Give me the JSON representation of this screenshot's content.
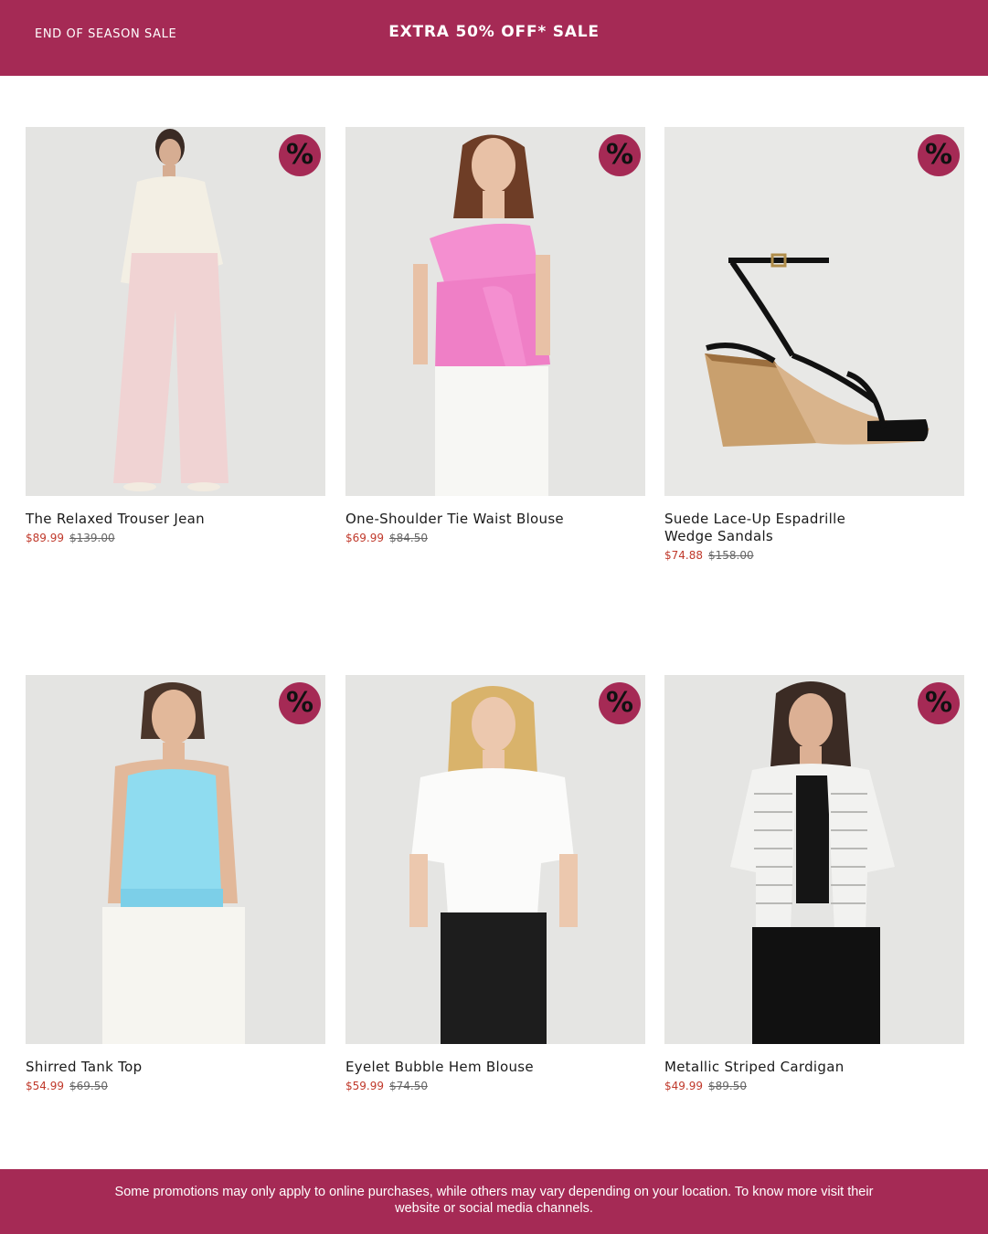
{
  "banner": {
    "left_label": "END OF SEASON SALE",
    "headline": "EXTRA 50% OFF* SALE"
  },
  "badge_glyph": "%",
  "products": [
    {
      "name": "The Relaxed Trouser Jean",
      "sale_price": "$89.99",
      "original_price": "$139.00"
    },
    {
      "name": "One-Shoulder Tie Waist Blouse",
      "sale_price": "$69.99",
      "original_price": "$84.50"
    },
    {
      "name": "Suede Lace-Up Espadrille Wedge Sandals",
      "sale_price": "$74.88",
      "original_price": "$158.00"
    },
    {
      "name": "Shirred Tank Top",
      "sale_price": "$54.99",
      "original_price": "$69.50"
    },
    {
      "name": "Eyelet Bubble Hem Blouse",
      "sale_price": "$59.99",
      "original_price": "$74.50"
    },
    {
      "name": "Metallic Striped Cardigan",
      "sale_price": "$49.99",
      "original_price": "$89.50"
    }
  ],
  "footer": {
    "disclaimer": "Some promotions may only apply to online purchases, while others may vary depending on your location. To know more visit their website or social media channels."
  },
  "colors": {
    "brand": "#a52a55",
    "sale_price": "#c0392b",
    "image_bg": "#e6e6e6"
  }
}
